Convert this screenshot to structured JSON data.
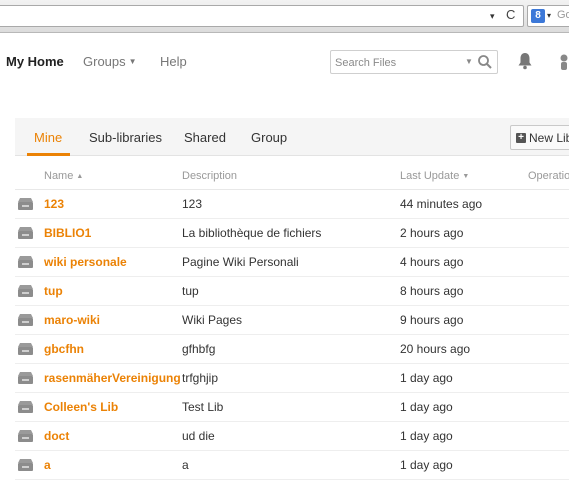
{
  "browser": {
    "url_dropdown_glyph": "▾",
    "reload_glyph": "C",
    "search_engine_icon": "google-search-engine-icon",
    "search_engine_letter": "8",
    "search_text": "Go"
  },
  "header": {
    "nav": {
      "home": "My Home",
      "groups": "Groups",
      "help": "Help"
    },
    "search": {
      "placeholder": "Search Files"
    }
  },
  "tabs": {
    "items": [
      {
        "label": "Mine",
        "active": true
      },
      {
        "label": "Sub-libraries",
        "active": false
      },
      {
        "label": "Shared",
        "active": false
      },
      {
        "label": "Group",
        "active": false
      }
    ],
    "new_library_label": "New Libr"
  },
  "table": {
    "columns": {
      "name": "Name",
      "description": "Description",
      "last_update": "Last Update",
      "operations": "Operatio"
    },
    "rows": [
      {
        "name": "123",
        "description": "123",
        "last_update": "44 minutes ago"
      },
      {
        "name": "BIBLIO1",
        "description": "La bibliothèque de fichiers",
        "last_update": "2 hours ago"
      },
      {
        "name": "wiki personale",
        "description": "Pagine Wiki Personali",
        "last_update": "4 hours ago"
      },
      {
        "name": "tup",
        "description": "tup",
        "last_update": "8 hours ago"
      },
      {
        "name": "maro-wiki",
        "description": "Wiki Pages",
        "last_update": "9 hours ago"
      },
      {
        "name": "gbcfhn",
        "description": "gfhbfg",
        "last_update": "20 hours ago"
      },
      {
        "name": "rasenmäherVereinigung",
        "description": "trfghjip",
        "last_update": "1 day ago"
      },
      {
        "name": "Colleen's Lib",
        "description": "Test Lib",
        "last_update": "1 day ago"
      },
      {
        "name": "doct",
        "description": "ud die",
        "last_update": "1 day ago"
      },
      {
        "name": "a",
        "description": "a",
        "last_update": "1 day ago"
      }
    ]
  },
  "colors": {
    "accent": "#eb8205",
    "tab_bar_bg": "#f5f5f5",
    "muted_text": "#999999"
  }
}
